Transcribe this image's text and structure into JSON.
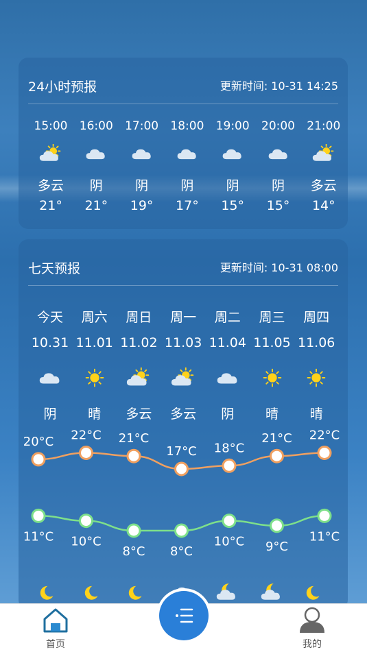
{
  "hourly": {
    "title": "24小时预报",
    "update": "更新时间: 10-31 14:25",
    "items": [
      {
        "time": "15:00",
        "cond": "多云",
        "temp": "21°",
        "icon": "partly-cloudy-icon"
      },
      {
        "time": "16:00",
        "cond": "阴",
        "temp": "21°",
        "icon": "cloud-icon"
      },
      {
        "time": "17:00",
        "cond": "阴",
        "temp": "19°",
        "icon": "cloud-icon"
      },
      {
        "time": "18:00",
        "cond": "阴",
        "temp": "17°",
        "icon": "cloud-icon"
      },
      {
        "time": "19:00",
        "cond": "阴",
        "temp": "15°",
        "icon": "cloud-icon"
      },
      {
        "time": "20:00",
        "cond": "阴",
        "temp": "15°",
        "icon": "cloud-icon"
      },
      {
        "time": "21:00",
        "cond": "多云",
        "temp": "14°",
        "icon": "partly-cloudy-icon"
      }
    ]
  },
  "seven": {
    "title": "七天预报",
    "update": "更新时间: 10-31 08:00",
    "days": [
      {
        "day": "今天",
        "date": "10.31",
        "cond": "阴",
        "icon": "cloud-icon",
        "high": "20°C",
        "low": "11°C",
        "high_val": 20,
        "low_val": 11,
        "night_icon": "moon-icon"
      },
      {
        "day": "周六",
        "date": "11.01",
        "cond": "晴",
        "icon": "sun-icon",
        "high": "22°C",
        "low": "10°C",
        "high_val": 22,
        "low_val": 10,
        "night_icon": "moon-icon"
      },
      {
        "day": "周日",
        "date": "11.02",
        "cond": "多云",
        "icon": "partly-cloudy-icon",
        "high": "21°C",
        "low": "8°C",
        "high_val": 21,
        "low_val": 8,
        "night_icon": "moon-icon"
      },
      {
        "day": "周一",
        "date": "11.03",
        "cond": "多云",
        "icon": "partly-cloudy-icon",
        "high": "17°C",
        "low": "8°C",
        "high_val": 17,
        "low_val": 8,
        "night_icon": "cloud-icon"
      },
      {
        "day": "周二",
        "date": "11.04",
        "cond": "阴",
        "icon": "cloud-icon",
        "high": "18°C",
        "low": "10°C",
        "high_val": 18,
        "low_val": 10,
        "night_icon": "cloudy-moon-icon"
      },
      {
        "day": "周三",
        "date": "11.05",
        "cond": "晴",
        "icon": "sun-icon",
        "high": "21°C",
        "low": "9°C",
        "high_val": 21,
        "low_val": 9,
        "night_icon": "cloudy-moon-icon"
      },
      {
        "day": "周四",
        "date": "11.06",
        "cond": "晴",
        "icon": "sun-icon",
        "high": "22°C",
        "low": "11°C",
        "high_val": 22,
        "low_val": 11,
        "night_icon": "moon-icon"
      }
    ]
  },
  "colors": {
    "high_line": "#f0a060",
    "low_line": "#7ee08a",
    "accent": "#2a7fd8"
  },
  "nav": {
    "home_label": "首页",
    "mine_label": "我的",
    "center_icon": "menu-icon"
  }
}
